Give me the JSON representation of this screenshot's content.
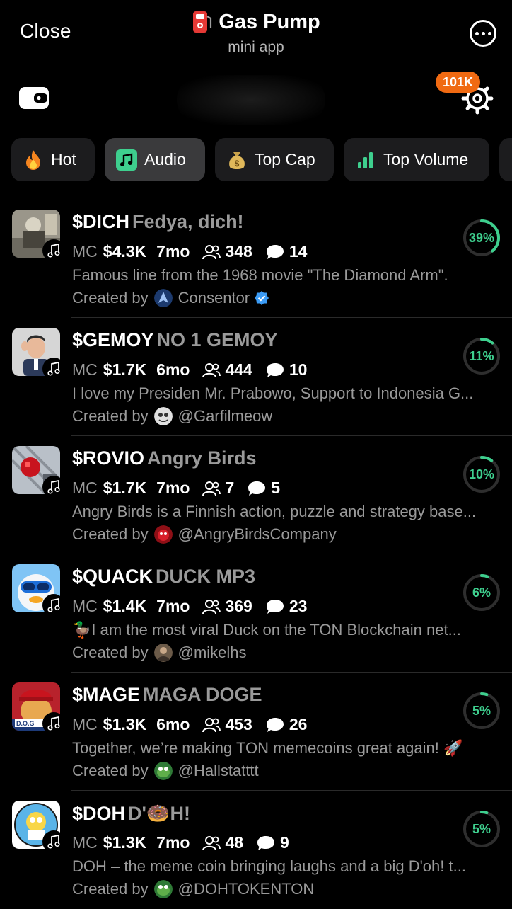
{
  "header": {
    "close_label": "Close",
    "title": "Gas Pump",
    "subtitle": "mini app",
    "badge": "101K"
  },
  "tabs": [
    {
      "label": "Hot",
      "icon": "fire-icon",
      "active": false
    },
    {
      "label": "Audio",
      "icon": "music-note-icon",
      "active": true
    },
    {
      "label": "Top Cap",
      "icon": "money-bag-icon",
      "active": false
    },
    {
      "label": "Top Volume",
      "icon": "bar-chart-icon",
      "active": false
    }
  ],
  "colors": {
    "accent": "#3ecf8e",
    "badge": "#f06a12",
    "verified": "#3b9bf5"
  },
  "tokens": [
    {
      "ticker": "$DICH",
      "name": "Fedya, dich!",
      "mc_label": "MC",
      "mc": "$4.3K",
      "age": "7mo",
      "holders": "348",
      "comments": "14",
      "description": "Famous line from the 1968 movie \"The Diamond Arm\".",
      "created_by": "Created by",
      "creator": "Consentor",
      "verified": true,
      "progress_label": "39%",
      "progress": 0.39
    },
    {
      "ticker": "$GEMOY",
      "name": "NO 1 GEMOY",
      "mc_label": "MC",
      "mc": "$1.7K",
      "age": "6mo",
      "holders": "444",
      "comments": "10",
      "description": "I love my Presiden Mr. Prabowo, Support to Indonesia G...",
      "created_by": "Created by",
      "creator": "@Garfilmeow",
      "verified": false,
      "progress_label": "11%",
      "progress": 0.11
    },
    {
      "ticker": "$ROVIO",
      "name": "Angry Birds",
      "mc_label": "MC",
      "mc": "$1.7K",
      "age": "7mo",
      "holders": "7",
      "comments": "5",
      "description": "Angry Birds is a Finnish action, puzzle and strategy base...",
      "created_by": "Created by",
      "creator": "@AngryBirdsCompany",
      "verified": false,
      "progress_label": "10%",
      "progress": 0.1
    },
    {
      "ticker": "$QUACK",
      "name": "DUCK MP3",
      "mc_label": "MC",
      "mc": "$1.4K",
      "age": "7mo",
      "holders": "369",
      "comments": "23",
      "description": "🦆I am the most viral Duck on the TON Blockchain net...",
      "created_by": "Created by",
      "creator": "@mikelhs",
      "verified": false,
      "progress_label": "6%",
      "progress": 0.06
    },
    {
      "ticker": "$MAGE",
      "name": "MAGA DOGE",
      "mc_label": "MC",
      "mc": "$1.3K",
      "age": "6mo",
      "holders": "453",
      "comments": "26",
      "description": "Together, we’re making TON memecoins great again! 🚀",
      "created_by": "Created by",
      "creator": "@Hallstatttt",
      "verified": false,
      "progress_label": "5%",
      "progress": 0.05
    },
    {
      "ticker": "$DOH",
      "name": "D'🍩H!",
      "mc_label": "MC",
      "mc": "$1.3K",
      "age": "7mo",
      "holders": "48",
      "comments": "9",
      "description": "DOH – the meme coin bringing laughs and a big D'oh! t...",
      "created_by": "Created by",
      "creator": "@DOHTOKENTON",
      "verified": false,
      "progress_label": "5%",
      "progress": 0.05
    }
  ]
}
